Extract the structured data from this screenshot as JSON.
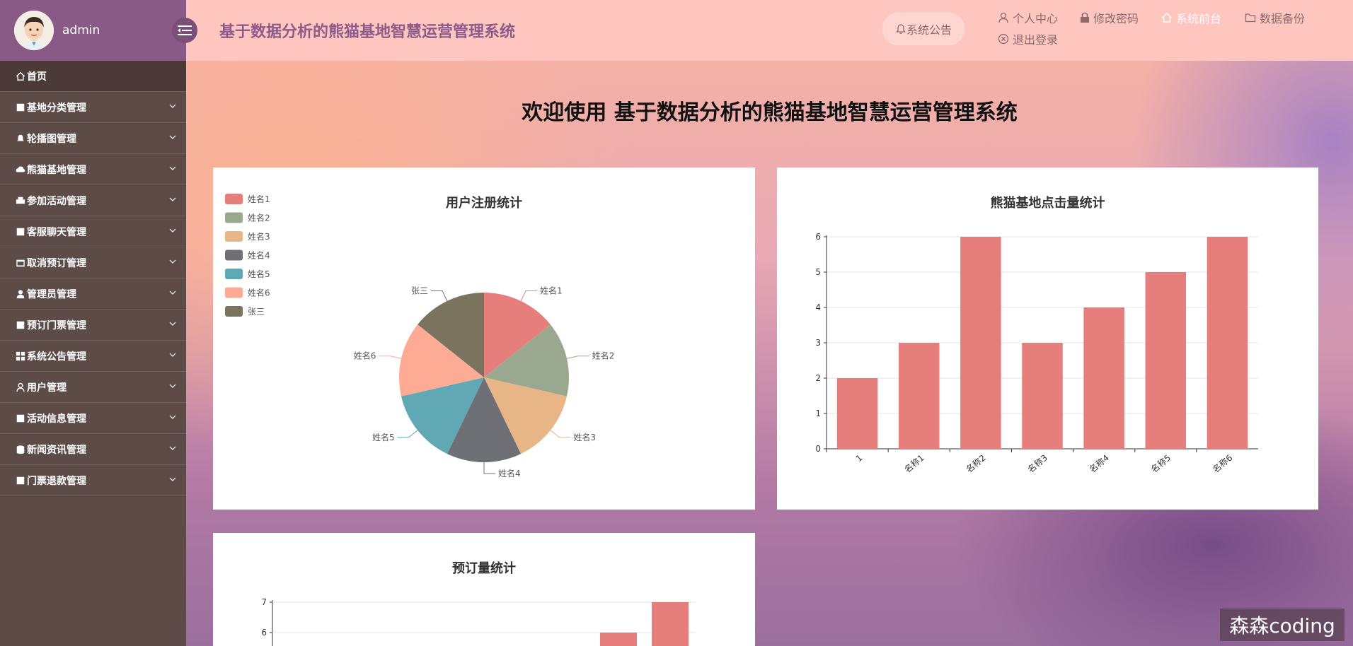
{
  "user": {
    "name": "admin"
  },
  "header": {
    "title": "基于数据分析的熊猫基地智慧运营管理系统",
    "notice_label": "系统公告",
    "links": {
      "profile": "个人中心",
      "change_password": "修改密码",
      "front": "系统前台",
      "backup": "数据备份",
      "logout": "退出登录"
    }
  },
  "sidebar": {
    "items": [
      {
        "label": "首页",
        "icon": "home-icon"
      },
      {
        "label": "基地分类管理",
        "icon": "doc-icon"
      },
      {
        "label": "轮播图管理",
        "icon": "bell-icon"
      },
      {
        "label": "熊猫基地管理",
        "icon": "cloud-icon"
      },
      {
        "label": "参加活动管理",
        "icon": "printer-icon"
      },
      {
        "label": "客服聊天管理",
        "icon": "doc-icon"
      },
      {
        "label": "取消预订管理",
        "icon": "calendar-icon"
      },
      {
        "label": "管理员管理",
        "icon": "user-icon"
      },
      {
        "label": "预订门票管理",
        "icon": "doc-icon"
      },
      {
        "label": "系统公告管理",
        "icon": "grid-icon"
      },
      {
        "label": "用户管理",
        "icon": "user-outline-icon"
      },
      {
        "label": "活动信息管理",
        "icon": "doc-icon"
      },
      {
        "label": "新闻资讯管理",
        "icon": "drum-icon"
      },
      {
        "label": "门票退款管理",
        "icon": "doc-icon"
      }
    ]
  },
  "welcome": "欢迎使用 基于数据分析的熊猫基地智慧运营管理系统",
  "watermark": "森森coding",
  "colors": {
    "sidebar_bg": "#5c4b47",
    "topbar_bg": "#ffc6bf",
    "brand_bg": "#8a5a86",
    "bar": "#e67f7b"
  },
  "chart_data": [
    {
      "type": "pie",
      "title": "用户注册统计",
      "legend_position": "top-left",
      "labels": [
        "姓名1",
        "姓名2",
        "姓名3",
        "姓名4",
        "姓名5",
        "姓名6",
        "张三"
      ],
      "values": [
        1,
        1,
        1,
        1,
        1,
        1,
        1
      ],
      "colors": [
        "#e67f7b",
        "#99a88e",
        "#e8b586",
        "#6f7076",
        "#61a8b5",
        "#fdab94",
        "#7a745f"
      ]
    },
    {
      "type": "bar",
      "title": "熊猫基地点击量统计",
      "categories": [
        "1",
        "名称1",
        "名称2",
        "名称3",
        "名称4",
        "名称5",
        "名称6"
      ],
      "values": [
        2,
        3,
        6,
        3,
        4,
        5,
        6
      ],
      "ylim": [
        0,
        6
      ],
      "yticks": [
        "0",
        "1",
        "2",
        "3",
        "4",
        "5",
        "6"
      ],
      "grid": true
    },
    {
      "type": "bar",
      "title": "预订量统计",
      "yticks_visible": [
        "7",
        "6"
      ],
      "ylim": [
        0,
        7
      ],
      "visible_values": [
        6,
        7
      ],
      "grid": true
    }
  ]
}
